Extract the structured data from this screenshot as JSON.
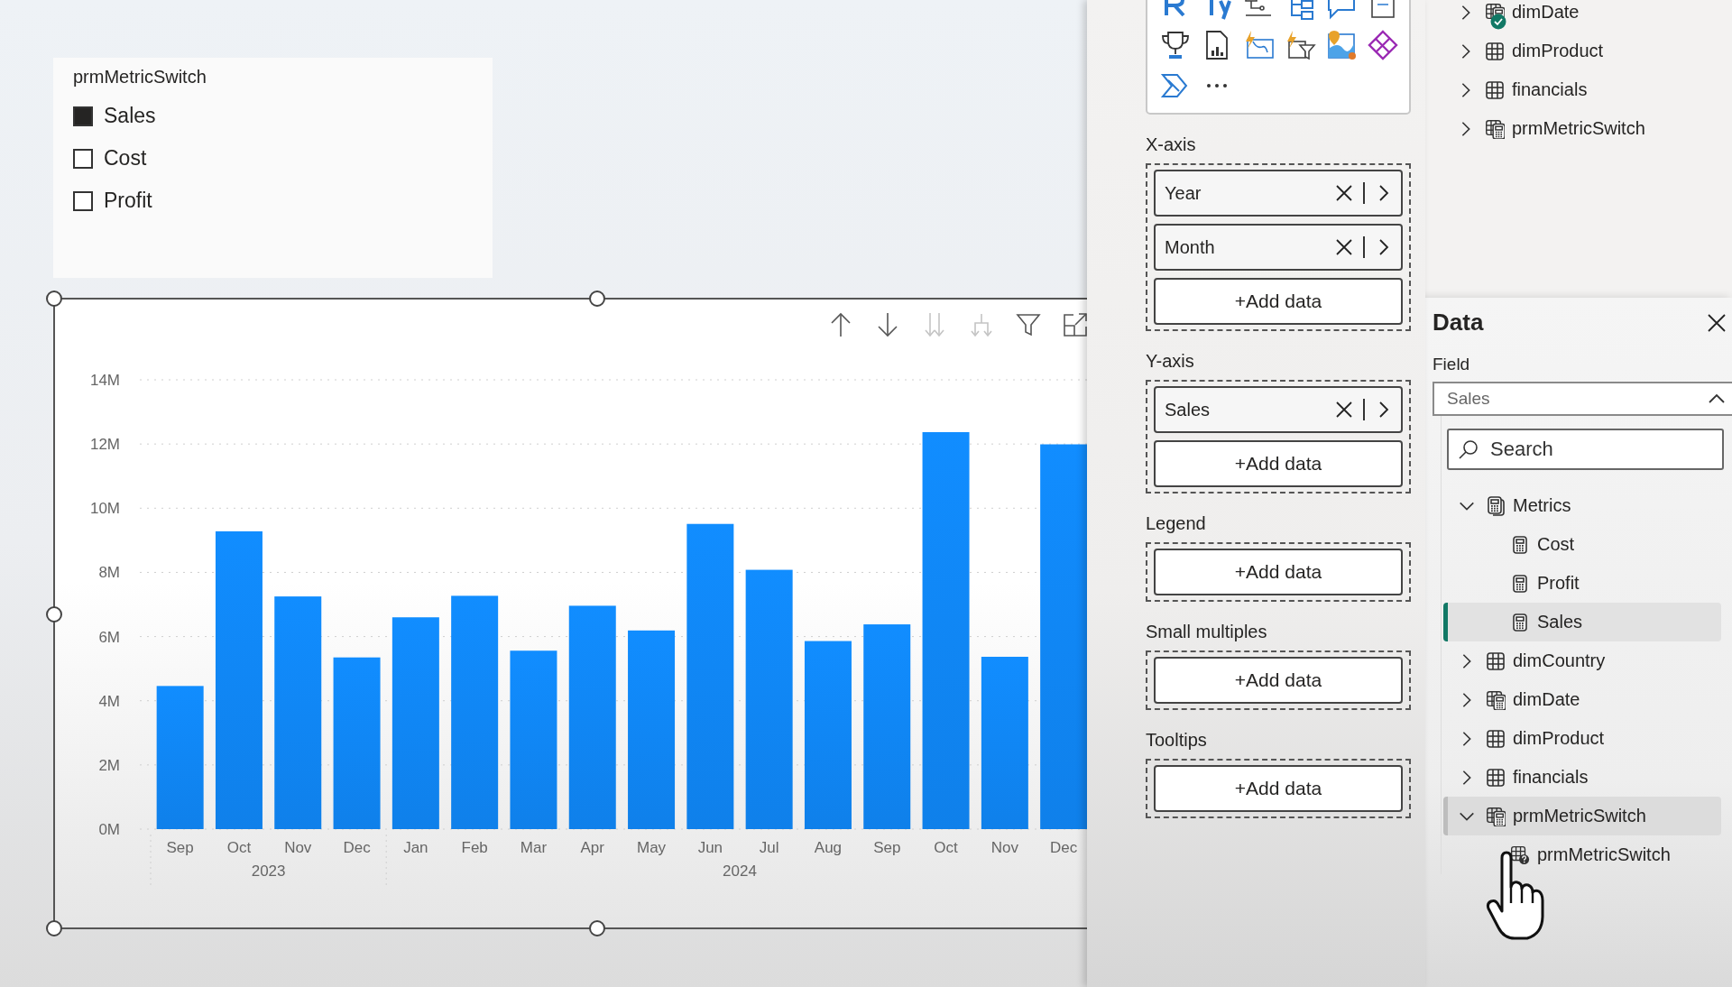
{
  "slicer": {
    "title": "prmMetricSwitch",
    "options": [
      {
        "label": "Sales",
        "checked": true
      },
      {
        "label": "Cost",
        "checked": false
      },
      {
        "label": "Profit",
        "checked": false
      }
    ]
  },
  "chart": {
    "toolbar": [
      {
        "kind": "up",
        "disabled": false
      },
      {
        "kind": "down",
        "disabled": false
      },
      {
        "kind": "double_down",
        "disabled": true
      },
      {
        "kind": "expand",
        "disabled": true
      },
      {
        "kind": "filter",
        "disabled": false
      },
      {
        "kind": "focus",
        "disabled": false
      }
    ],
    "year_labels": [
      "2023",
      "2024"
    ],
    "chart_data": {
      "type": "bar",
      "categories": [
        "Sep",
        "Oct",
        "Nov",
        "Dec",
        "Jan",
        "Feb",
        "Mar",
        "Apr",
        "May",
        "Jun",
        "Jul",
        "Aug",
        "Sep",
        "Oct",
        "Nov",
        "Dec"
      ],
      "grid": true,
      "values": [
        4.46,
        9.28,
        7.25,
        5.35,
        6.6,
        7.27,
        5.56,
        6.96,
        6.19,
        9.51,
        8.08,
        5.86,
        6.38,
        12.37,
        5.37,
        11.99
      ],
      "ylim": [
        0,
        14
      ],
      "yticks": [
        {
          "value": 0,
          "label": "0M"
        },
        {
          "value": 2,
          "label": "2M"
        },
        {
          "value": 4,
          "label": "4M"
        },
        {
          "value": 6,
          "label": "6M"
        },
        {
          "value": 8,
          "label": "8M"
        },
        {
          "value": 10,
          "label": "10M"
        },
        {
          "value": 12,
          "label": "12M"
        },
        {
          "value": 14,
          "label": "14M"
        }
      ]
    }
  },
  "visualizations": {
    "wells": [
      {
        "label": "X-axis",
        "fields": [
          {
            "name": "Year"
          },
          {
            "name": "Month"
          }
        ],
        "add_label": "+Add data"
      },
      {
        "label": "Y-axis",
        "fields": [
          {
            "name": "Sales"
          }
        ],
        "add_label": "+Add data"
      },
      {
        "label": "Legend",
        "add_label": "+Add data"
      },
      {
        "label": "Small multiples",
        "add_label": "+Add data"
      },
      {
        "label": "Tooltips",
        "add_label": "+Add data"
      }
    ]
  },
  "data_pane": {
    "tables": [
      {
        "name": "dimDate",
        "kind": "calc_table",
        "synced": true,
        "expanded": false
      },
      {
        "name": "dimProduct",
        "kind": "table",
        "synced": false,
        "expanded": false
      },
      {
        "name": "financials",
        "kind": "table",
        "synced": false,
        "expanded": false
      },
      {
        "name": "prmMetricSwitch",
        "kind": "calc_table",
        "synced": false,
        "expanded": false
      }
    ]
  },
  "data_popup": {
    "title": "Data",
    "field_label": "Field",
    "field_value": "Sales",
    "search_placeholder": "Search",
    "tree": [
      {
        "name": "Metrics",
        "kind": "measure_group",
        "expanded": true,
        "selected": false,
        "hovered": false,
        "children": [
          {
            "name": "Cost",
            "kind": "measure",
            "selected": false,
            "hovered": false
          },
          {
            "name": "Profit",
            "kind": "measure",
            "selected": false,
            "hovered": false
          },
          {
            "name": "Sales",
            "kind": "measure",
            "selected": true,
            "hovered": false
          }
        ]
      },
      {
        "name": "dimCountry",
        "kind": "table",
        "expanded": false,
        "selected": false,
        "hovered": false
      },
      {
        "name": "dimDate",
        "kind": "calc_table",
        "expanded": false,
        "selected": false,
        "hovered": false
      },
      {
        "name": "dimProduct",
        "kind": "table",
        "expanded": false,
        "selected": false,
        "hovered": false
      },
      {
        "name": "financials",
        "kind": "table",
        "expanded": false,
        "selected": false,
        "hovered": false
      },
      {
        "name": "prmMetricSwitch",
        "kind": "calc_table",
        "expanded": true,
        "selected": false,
        "hovered": true,
        "children": [
          {
            "name": "prmMetricSwitch",
            "kind": "parameter",
            "selected": false,
            "hovered": false
          }
        ]
      }
    ]
  }
}
